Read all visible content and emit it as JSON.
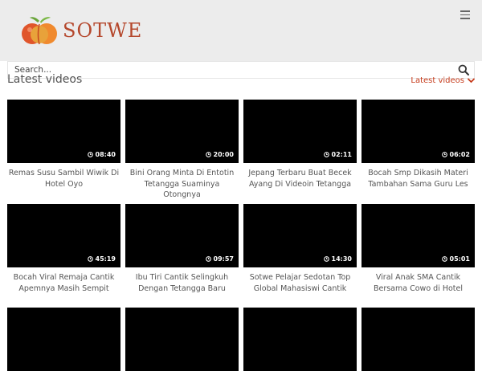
{
  "brand": {
    "name": "SOTWE",
    "logo_icon": "peach-icon",
    "accent": "#c63b1b"
  },
  "search": {
    "placeholder": "Search...",
    "icon": "search-icon"
  },
  "section": {
    "title": "Latest videos",
    "sort_label": "Latest videos"
  },
  "videos": [
    {
      "title": "Remas Susu Sambil Wiwik Di Hotel Oyo",
      "duration": "08:40"
    },
    {
      "title": "Bini Orang Minta Di Entotin Tetangga Suaminya Otongnya",
      "duration": "20:00"
    },
    {
      "title": "Jepang Terbaru Buat Becek Ayang Di Videoin Tetangga",
      "duration": "02:11"
    },
    {
      "title": "Bocah Smp Dikasih Materi Tambahan Sama Guru Les",
      "duration": "06:02"
    },
    {
      "title": "Bocah Viral Remaja Cantik Apemnya Masih Sempit",
      "duration": "45:19"
    },
    {
      "title": "Ibu Tiri Cantik Selingkuh Dengan Tetangga Baru",
      "duration": "09:57"
    },
    {
      "title": "Sotwe Pelajar Sedotan Top Global Mahasiswi Cantik",
      "duration": "14:30"
    },
    {
      "title": "Viral Anak SMA Cantik Bersama Cowo di Hotel",
      "duration": "05:01"
    }
  ]
}
